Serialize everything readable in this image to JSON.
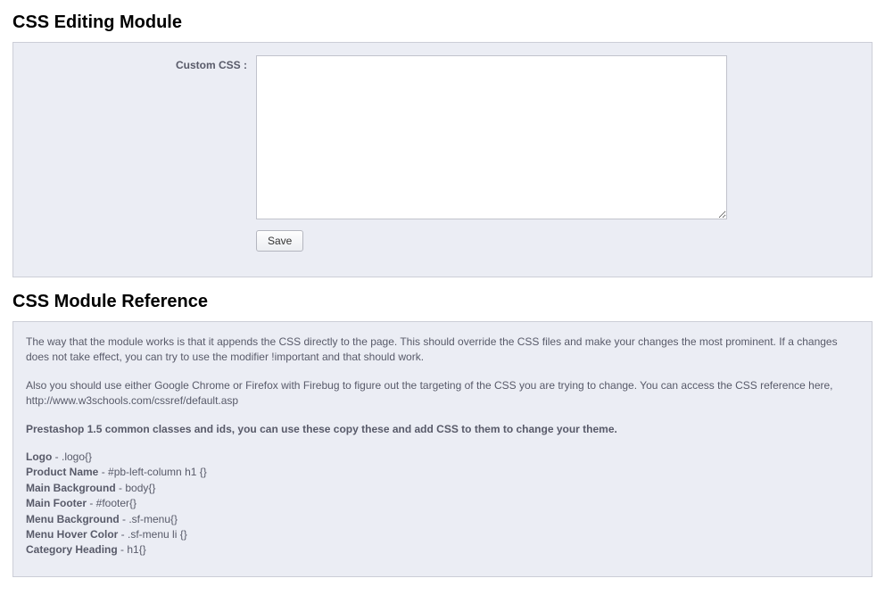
{
  "editing": {
    "title": "CSS Editing Module",
    "label": "Custom CSS :",
    "textarea_value": "",
    "save_label": "Save"
  },
  "reference": {
    "title": "CSS Module Reference",
    "para1": "The way that the module works is that it appends the CSS directly to the page. This should override the CSS files and make your changes the most prominent. If a changes does not take effect, you can try to use the modifier !important and that should work.",
    "para2": "Also you should use either Google Chrome or Firefox with Firebug to figure out the targeting of the CSS you are trying to change. You can access the CSS reference here, http://www.w3schools.com/cssref/default.asp",
    "heading": "Prestashop 1.5 common classes and ids, you can use these copy these and add CSS to them to change your theme.",
    "items": [
      {
        "name": "Logo",
        "sel": " - .logo{}"
      },
      {
        "name": "Product Name",
        "sel": " - #pb-left-column h1 {}"
      },
      {
        "name": "Main Background",
        "sel": " - body{}"
      },
      {
        "name": "Main Footer",
        "sel": " - #footer{}"
      },
      {
        "name": "Menu Background",
        "sel": " - .sf-menu{}"
      },
      {
        "name": "Menu Hover Color",
        "sel": " - .sf-menu li {}"
      },
      {
        "name": "Category Heading",
        "sel": " - h1{}"
      }
    ]
  }
}
